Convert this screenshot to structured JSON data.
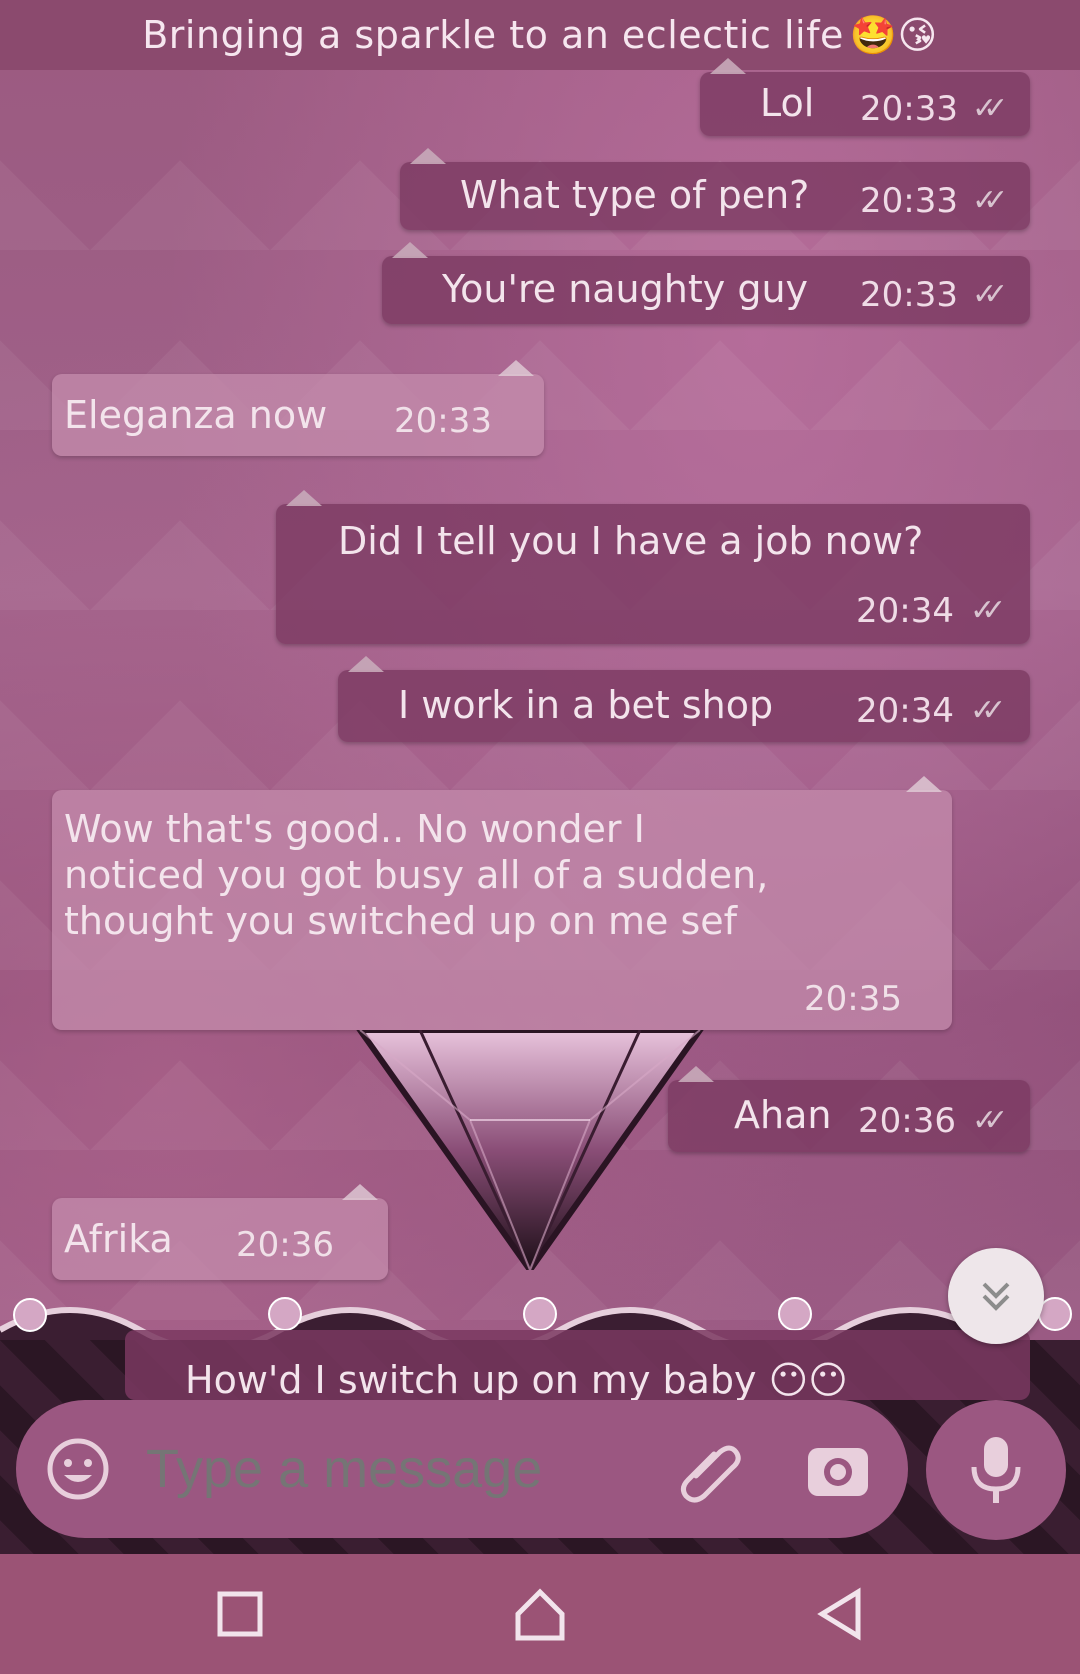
{
  "header": {
    "status_text": "Bringing a sparkle to an eclectic life",
    "emojis": "🤩😘"
  },
  "messages": [
    {
      "direction": "out",
      "text": "Lol",
      "time": "20:33",
      "status": "read"
    },
    {
      "direction": "out",
      "text": "What type of pen?",
      "time": "20:33",
      "status": "read"
    },
    {
      "direction": "out",
      "text": "You're naughty guy",
      "time": "20:33",
      "status": "read"
    },
    {
      "direction": "in",
      "text": "Eleganza now",
      "time": "20:33"
    },
    {
      "direction": "out",
      "text": "Did I tell you I have a job now?",
      "time": "20:34",
      "status": "read"
    },
    {
      "direction": "out",
      "text": "I work in a bet shop",
      "time": "20:34",
      "status": "read"
    },
    {
      "direction": "in",
      "text_lines": [
        "Wow that's good.. No wonder I",
        "noticed you got busy all of a sudden,",
        "thought you switched up on me sef"
      ],
      "time": "20:35"
    },
    {
      "direction": "out",
      "text": "Ahan",
      "time": "20:36",
      "status": "read"
    },
    {
      "direction": "in",
      "text": "Afrika",
      "time": "20:36"
    },
    {
      "direction": "out",
      "text": "How'd I switch up on my baby 😶😶",
      "partial": true
    }
  ],
  "composer": {
    "placeholder": "Type a message",
    "icons": [
      "emoji-icon",
      "attach-icon",
      "camera-icon",
      "mic-icon"
    ]
  },
  "scroll_button_icon": "double-chevron-down-icon",
  "navbar": {
    "icons": [
      "recents-icon",
      "home-icon",
      "back-icon"
    ]
  },
  "colors": {
    "header_bg": "#8b4a6e",
    "outgoing_bubble": "#7a3860",
    "incoming_bubble": "#c48cac",
    "input_bar": "#9b5781",
    "navbar_bg": "#9b5375"
  }
}
